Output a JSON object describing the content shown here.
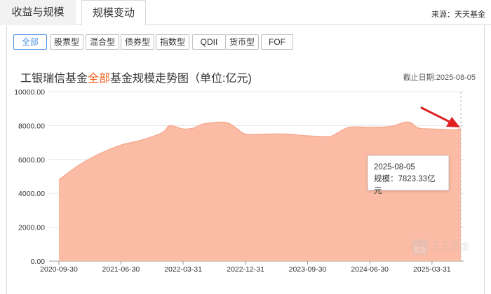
{
  "tabs": [
    {
      "label": "收益与规模",
      "active": false
    },
    {
      "label": "规模变动",
      "active": true
    }
  ],
  "source_text": "来源：天天基金",
  "filters": [
    {
      "label": "全部",
      "active": true
    },
    {
      "label": "股票型",
      "active": false
    },
    {
      "label": "混合型",
      "active": false
    },
    {
      "label": "债券型",
      "active": false
    },
    {
      "label": "指数型",
      "active": false
    },
    {
      "label": "QDII",
      "active": false
    },
    {
      "label": "货币型",
      "active": false
    },
    {
      "label": "FOF",
      "active": false
    }
  ],
  "chart_header": {
    "title_prefix": "工银瑞信基金",
    "title_highlight": "全部",
    "title_suffix": "基金规模走势图（单位:亿元)",
    "deadline": "截止日期:2025-08-05"
  },
  "tooltip": {
    "date": "2025-08-05",
    "value_text": "规模：7823.33亿元"
  },
  "watermark": {
    "box_text": "基金",
    "text": "天天基金"
  },
  "colors": {
    "area_fill": "#fbbba4",
    "area_line": "#f5a58a",
    "accent": "#f26522",
    "active_filter": "#4a90e2",
    "arrow": "#e02020"
  },
  "chart_data": {
    "type": "area",
    "title": "工银瑞信基金全部基金规模走势图（单位:亿元)",
    "xlabel": "",
    "ylabel": "",
    "ylim": [
      0,
      10000
    ],
    "yticks": [
      "0.00",
      "2000.00",
      "4000.00",
      "6000.00",
      "8000.00",
      "10000.00"
    ],
    "xticks": [
      "2020-09-30",
      "2021-06-30",
      "2022-03-31",
      "2022-12-31",
      "2023-09-30",
      "2024-06-30",
      "2025-03-31"
    ],
    "x_range": [
      "2020-09-30",
      "2025-08-05"
    ],
    "grid": "horizontal",
    "legend": "none",
    "series": [
      {
        "points": [
          [
            "2020-09-30",
            4800
          ],
          [
            "2020-12-31",
            5700
          ],
          [
            "2021-03-31",
            6350
          ],
          [
            "2021-06-30",
            6850
          ],
          [
            "2021-09-30",
            7150
          ],
          [
            "2021-12-31",
            7600
          ],
          [
            "2022-01-31",
            8000
          ],
          [
            "2022-03-31",
            7800
          ],
          [
            "2022-05-15",
            7850
          ],
          [
            "2022-06-30",
            8100
          ],
          [
            "2022-09-30",
            8200
          ],
          [
            "2022-11-15",
            7900
          ],
          [
            "2022-12-31",
            7500
          ],
          [
            "2023-03-31",
            7500
          ],
          [
            "2023-06-30",
            7500
          ],
          [
            "2023-09-30",
            7400
          ],
          [
            "2023-12-31",
            7350
          ],
          [
            "2024-01-31",
            7500
          ],
          [
            "2024-03-31",
            7900
          ],
          [
            "2024-06-30",
            7900
          ],
          [
            "2024-09-30",
            7950
          ],
          [
            "2024-11-30",
            8200
          ],
          [
            "2024-12-31",
            8150
          ],
          [
            "2025-01-31",
            7850
          ],
          [
            "2025-03-31",
            7800
          ],
          [
            "2025-06-30",
            7750
          ],
          [
            "2025-08-05",
            7823.33
          ]
        ]
      }
    ]
  }
}
